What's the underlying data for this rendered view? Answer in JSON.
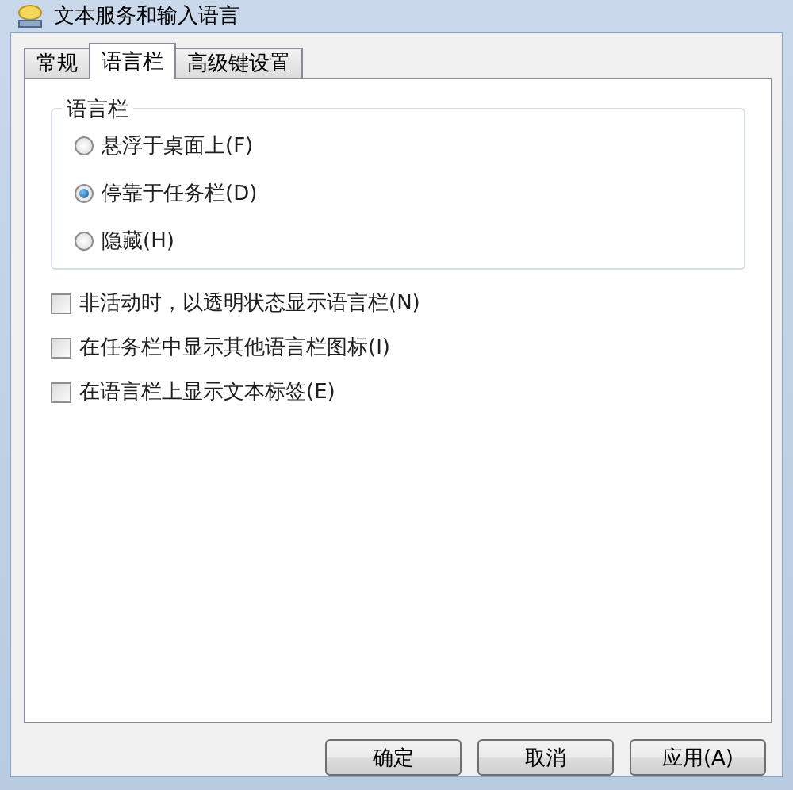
{
  "window": {
    "title": "文本服务和输入语言"
  },
  "tabs": [
    {
      "label": "常规",
      "selected": false
    },
    {
      "label": "语言栏",
      "selected": true
    },
    {
      "label": "高级键设置",
      "selected": false
    }
  ],
  "language_bar_group": {
    "title": "语言栏",
    "options": [
      {
        "label": "悬浮于桌面上(F)",
        "selected": false
      },
      {
        "label": "停靠于任务栏(D)",
        "selected": true
      },
      {
        "label": "隐藏(H)",
        "selected": false
      }
    ]
  },
  "checkboxes": [
    {
      "label": "非活动时，以透明状态显示语言栏(N)",
      "checked": false
    },
    {
      "label": "在任务栏中显示其他语言栏图标(I)",
      "checked": false
    },
    {
      "label": "在语言栏上显示文本标签(E)",
      "checked": false
    }
  ],
  "buttons": [
    "确定",
    "取消",
    "应用(A)"
  ]
}
